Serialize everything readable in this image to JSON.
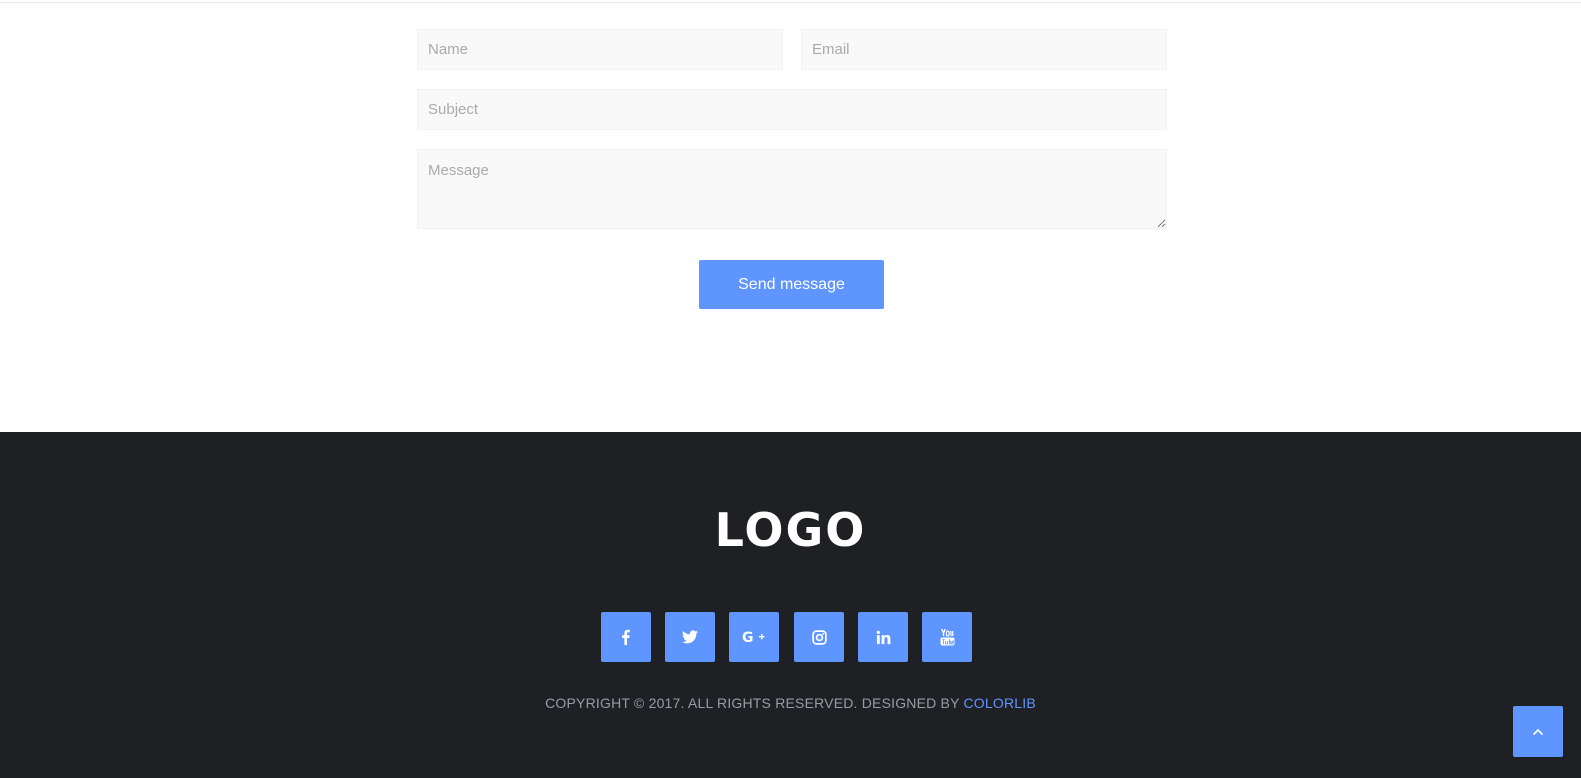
{
  "contact_form": {
    "name_placeholder": "Name",
    "email_placeholder": "Email",
    "subject_placeholder": "Subject",
    "message_placeholder": "Message",
    "send_label": "Send message"
  },
  "footer": {
    "logo_text": "LOGO",
    "social_icons": [
      "facebook-icon",
      "twitter-icon",
      "google-plus-icon",
      "instagram-icon",
      "linkedin-icon",
      "youtube-icon"
    ],
    "copyright_prefix": "COPYRIGHT © 2017. ALL RIGHTS RESERVED. DESIGNED BY",
    "copyright_link": "COLORLIB"
  },
  "back_to_top_icon": "chevron-up-icon",
  "colors": {
    "accent": "#5f95ff",
    "footer_background": "#1f2024",
    "input_background": "#f9f9f9",
    "copyright_text": "#9a9ca3"
  }
}
